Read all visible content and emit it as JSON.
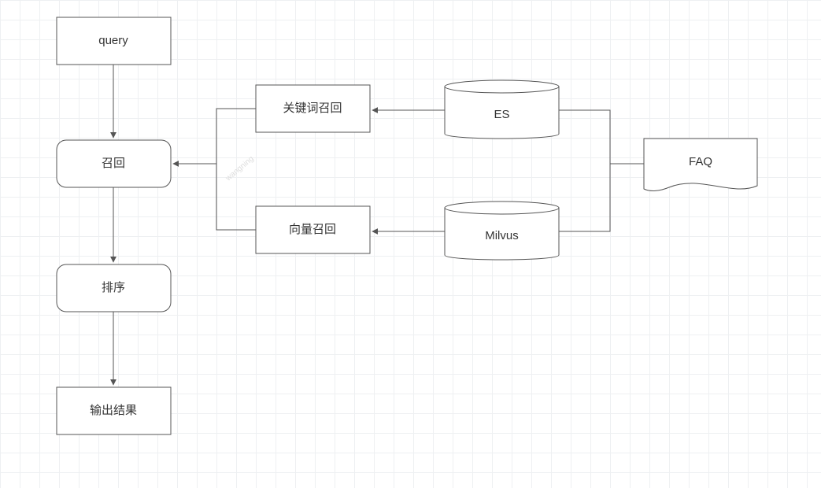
{
  "nodes": {
    "query": "query",
    "recall": "召回",
    "rank": "排序",
    "output": "输出结果",
    "kw": "关键词召回",
    "vec": "向量召回",
    "es": "ES",
    "milvus": "Milvus",
    "faq": "FAQ"
  },
  "watermark": "wangning"
}
